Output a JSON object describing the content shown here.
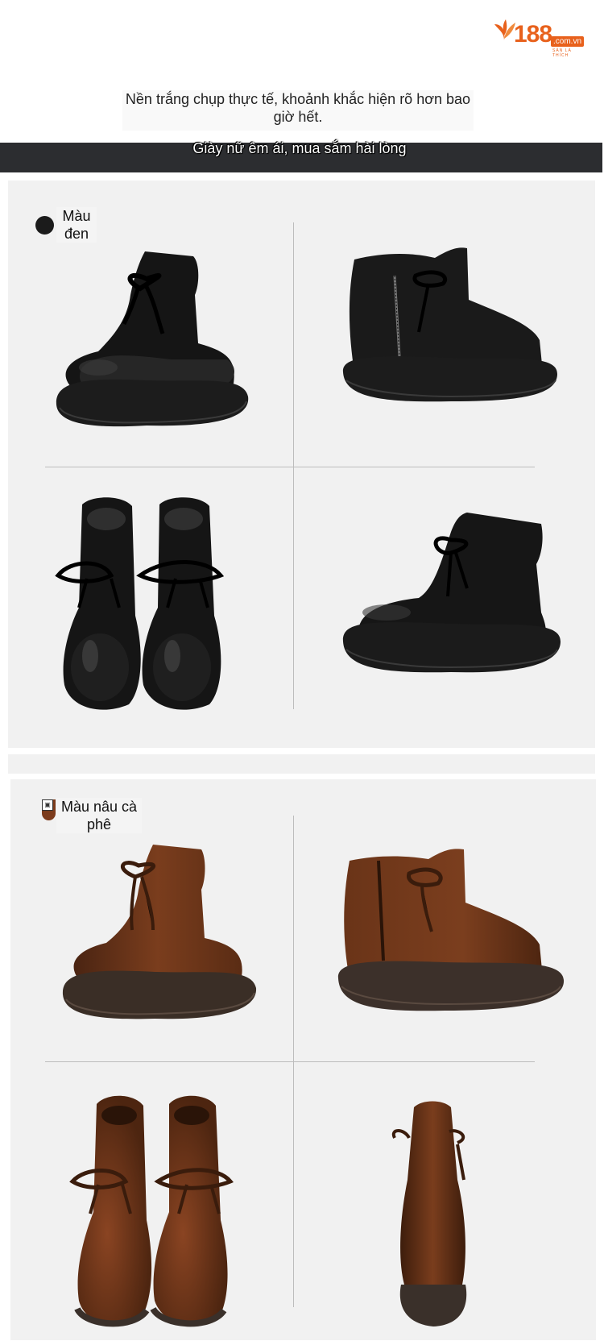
{
  "logo": {
    "number": "188",
    "domain": ".com.vn",
    "tagline": "SĂN LÀ THÍCH"
  },
  "header": {
    "tagline": "Nền trắng chụp thực tế, khoảnh khắc hiện rõ hơn bao giờ hết.",
    "banner": "Giày nữ êm ái, mua sắm hài lòng"
  },
  "variants": [
    {
      "label": "Màu đen",
      "color": "#1b1b1b"
    },
    {
      "label": "Màu nâu cà phê",
      "color": "#7c3b1c"
    }
  ]
}
